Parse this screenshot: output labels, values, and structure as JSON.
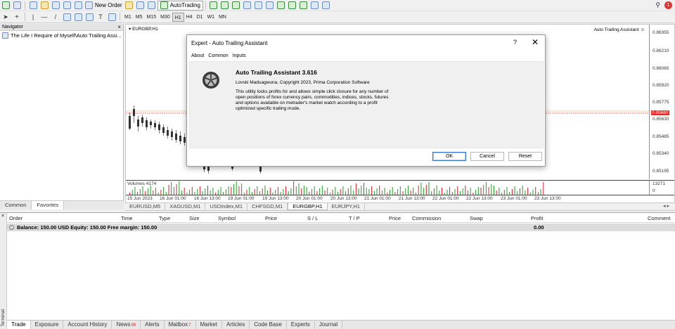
{
  "toolbar": {
    "new_order": "New Order",
    "autotrading": "AutoTrading",
    "timeframes": [
      "M1",
      "M5",
      "M15",
      "M30",
      "H1",
      "H4",
      "D1",
      "W1",
      "MN"
    ],
    "notifications_count": "1"
  },
  "navigator": {
    "title": "Navigator",
    "close": "×",
    "item": "The Life I Require of Myself\\Auto Trailing Assi...",
    "tabs": [
      "Common",
      "Favorites"
    ]
  },
  "chart": {
    "symbol": "EURGBP,H1",
    "ea_label": "Auto Trailing Assistant",
    "price_labels": [
      "0.86355",
      "0.86210",
      "0.86065",
      "0.85920",
      "0.85775",
      "0.85680",
      "0.85630",
      "0.85485",
      "0.85340",
      "0.85195"
    ],
    "current_price": "0.85680",
    "volumes_label": "Volumes 4174",
    "volume_axis": [
      "13271",
      "0"
    ],
    "time_labels": [
      "15 Jun 2023",
      "16 Jun 01:00",
      "16 Jun 13:00",
      "19 Jun 01:00",
      "19 Jun 13:00",
      "20 Jun 01:00",
      "20 Jun 13:00",
      "21 Jun 01:00",
      "21 Jun 13:00",
      "22 Jun 01:00",
      "22 Jun 13:00",
      "23 Jun 01:00",
      "23 Jun 13:00"
    ]
  },
  "chart_tabs": [
    "EURUSD,M5",
    "XAGUSD,M1",
    "USDIndex,M1",
    "CHFSGD,M1",
    "EURGBP,H1",
    "EURJPY,H1"
  ],
  "chart_tabs_arrows": "◂ ▸",
  "dialog": {
    "title": "Expert - Auto Trailing Assistant",
    "help": "?",
    "close": "✕",
    "tabs": [
      "About",
      "Common",
      "Inputs"
    ],
    "name": "Auto Trailing Assistant 3.616",
    "copyright": "Lovski Maduagwuna, Copyright 2023, Prima Corporation Software",
    "description": "This utility locks profits for and allows simple click closure for any number of open positions of forex currency pairs, commodities, indices, stocks, futures and options available on metrader's market watch according to a profit optimized specific trailing mode.",
    "buttons": {
      "ok": "OK",
      "cancel": "Cancel",
      "reset": "Reset"
    }
  },
  "terminal": {
    "side_label": "Terminal",
    "close": "×",
    "columns": [
      "Order",
      "Time",
      "Type",
      "Size",
      "Symbol",
      "Price",
      "S / L",
      "T / P",
      "Price",
      "Commission",
      "Swap",
      "Profit",
      "Comment"
    ],
    "balance_text": "Balance: 150.00 USD  Equity: 150.00  Free margin: 150.00",
    "balance_profit": "0.00",
    "tabs": [
      {
        "label": "Trade",
        "badge": ""
      },
      {
        "label": "Exposure",
        "badge": ""
      },
      {
        "label": "Account History",
        "badge": ""
      },
      {
        "label": "News",
        "badge": "99"
      },
      {
        "label": "Alerts",
        "badge": ""
      },
      {
        "label": "Mailbox",
        "badge": "7"
      },
      {
        "label": "Market",
        "badge": ""
      },
      {
        "label": "Articles",
        "badge": ""
      },
      {
        "label": "Code Base",
        "badge": ""
      },
      {
        "label": "Experts",
        "badge": ""
      },
      {
        "label": "Journal",
        "badge": ""
      }
    ]
  }
}
